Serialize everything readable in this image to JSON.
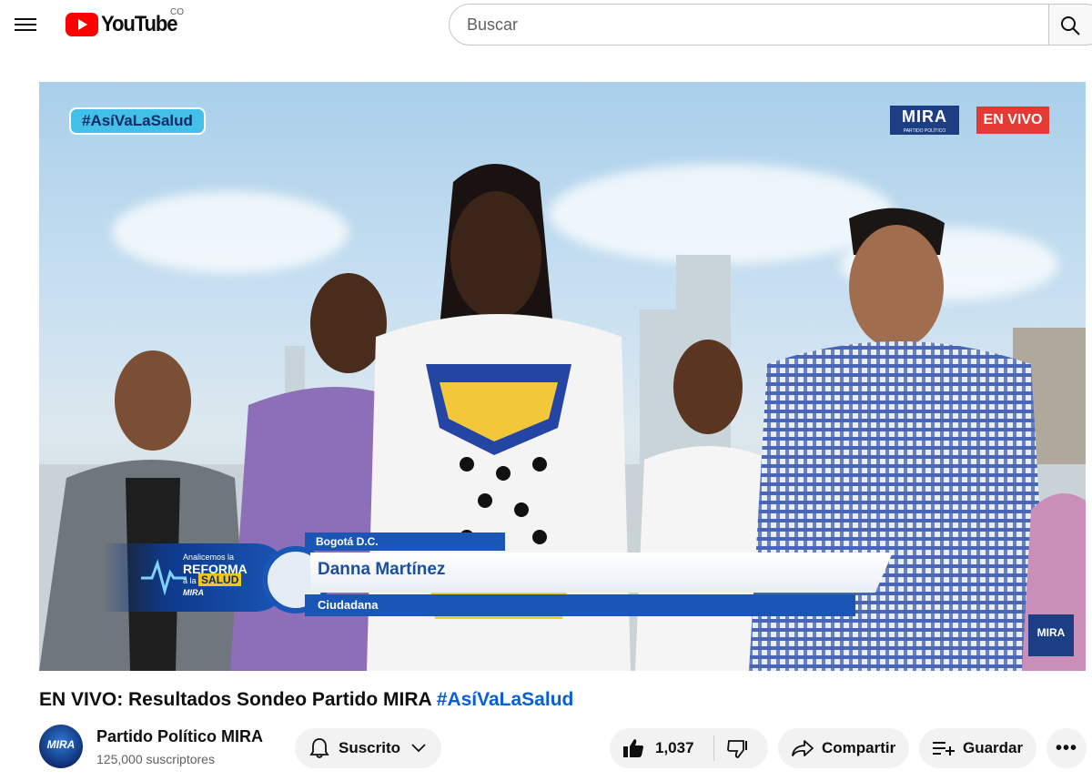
{
  "header": {
    "logo_text": "YouTube",
    "country_code": "CO",
    "search_placeholder": "Buscar",
    "icons": [
      "menu-icon",
      "youtube-logo-icon",
      "search-icon"
    ]
  },
  "video": {
    "overlay": {
      "hashtag": "#AsíVaLaSalud",
      "brand": "MIRA",
      "brand_sub": "PARTIDO POLÍTICO",
      "live_label": "EN VIVO",
      "lower_third": {
        "program_line1": "Analicemos la",
        "program_line2": "REFORMA",
        "program_line3": "a la",
        "program_line4": "SALUD",
        "program_brand": "MIRA",
        "city": "Bogotá D.C.",
        "name": "Danna Martínez",
        "role": "Ciudadana"
      },
      "corner_brand": "MIRA"
    },
    "title_prefix": "EN VIVO: Resultados Sondeo Partido MIRA",
    "title_hashtag": "#AsíVaLaSalud"
  },
  "channel": {
    "avatar_text": "MIRA",
    "name": "Partido Político MIRA",
    "subscribers": "125,000 suscriptores"
  },
  "actions": {
    "subscribed_label": "Suscrito",
    "like_count": "1,037",
    "share_label": "Compartir",
    "save_label": "Guardar",
    "more_label": "•••"
  },
  "colors": {
    "youtube_red": "#ff0000",
    "link_blue": "#065fd4",
    "live_red": "#e53935",
    "mira_blue": "#1c3f84"
  }
}
